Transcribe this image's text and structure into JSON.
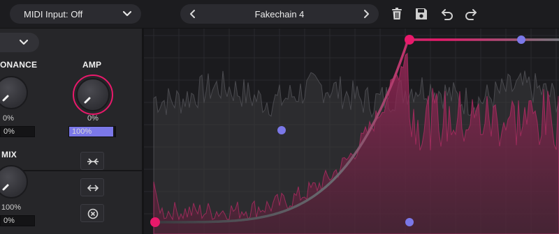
{
  "header": {
    "midi_input": "MIDI Input: Off",
    "preset_name": "Fakechain 4",
    "icons": [
      "chevron-down-icon",
      "chevron-left-icon",
      "chevron-right-icon",
      "trash-icon",
      "save-icon",
      "undo-icon",
      "redo-icon"
    ]
  },
  "panel": {
    "resonance": {
      "label": "ONANCE",
      "percent": "0%",
      "value": "0%"
    },
    "amp": {
      "label": "AMP",
      "percent": "0%",
      "value": "100%",
      "fill_fraction": 0.95
    },
    "mix": {
      "label": "MIX",
      "percent": "100%",
      "value": "0%"
    },
    "buttons": [
      "compress-icon",
      "expand-arrows-icon",
      "close-circle-icon"
    ]
  },
  "colors": {
    "accent": "#e9196b",
    "purple": "#7b78e8",
    "background": "#1e1e21"
  }
}
